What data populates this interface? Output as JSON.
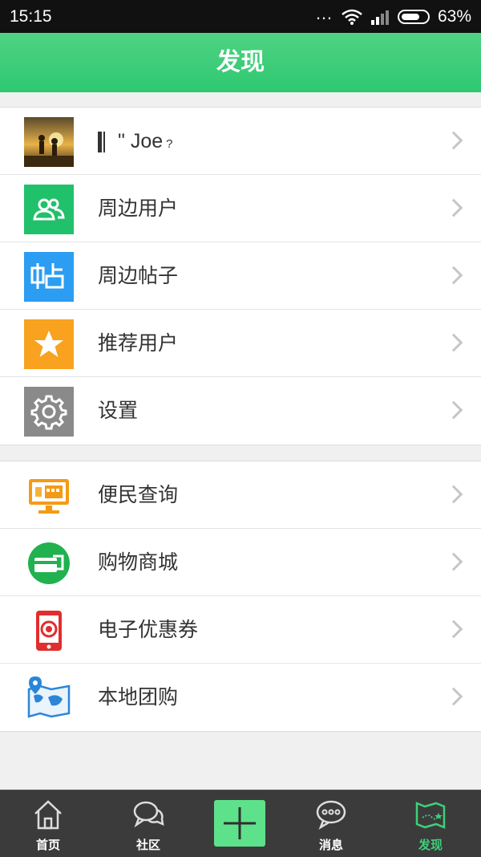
{
  "status": {
    "time": "15:15",
    "battery": "63%"
  },
  "header": {
    "title": "发现"
  },
  "group1": {
    "profile_name": "\" Joe",
    "profile_suffix": "?",
    "items": [
      {
        "label": "周边用户",
        "icon": "users-icon",
        "color": "#21c06b"
      },
      {
        "label": "周边帖子",
        "icon": "post-icon",
        "color": "#2b9df2"
      },
      {
        "label": "推荐用户",
        "icon": "star-icon",
        "color": "#f8a21f"
      },
      {
        "label": "设置",
        "icon": "gear-icon",
        "color": "#8a8a8a"
      }
    ]
  },
  "group2": {
    "items": [
      {
        "label": "便民查询",
        "icon": "monitor-icon"
      },
      {
        "label": "购物商城",
        "icon": "card-icon"
      },
      {
        "label": "电子优惠券",
        "icon": "phone-coupon-icon"
      },
      {
        "label": "本地团购",
        "icon": "map-icon"
      }
    ]
  },
  "tabbar": {
    "tabs": [
      {
        "label": "首页",
        "icon": "home-icon"
      },
      {
        "label": "社区",
        "icon": "chat-icon"
      },
      {
        "label": "",
        "icon": "plus-icon"
      },
      {
        "label": "消息",
        "icon": "message-icon"
      },
      {
        "label": "发现",
        "icon": "discover-map-icon",
        "active": true
      }
    ]
  }
}
